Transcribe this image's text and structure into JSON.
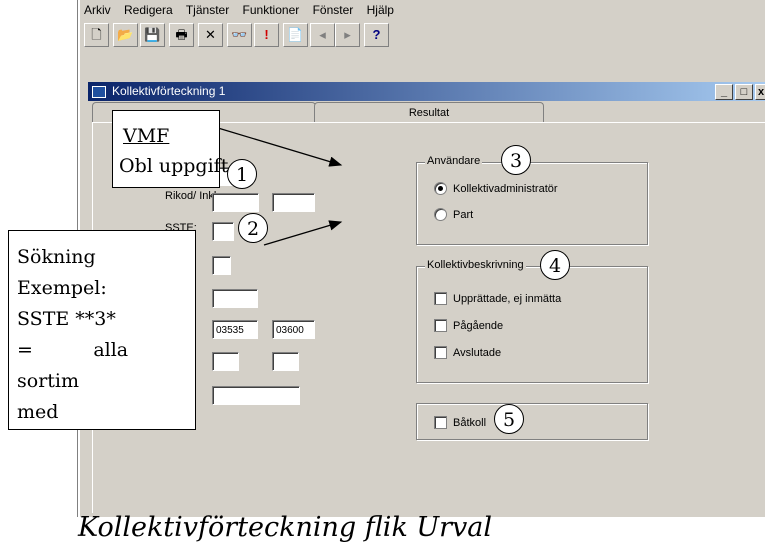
{
  "menu": [
    "Arkiv",
    "Redigera",
    "Tjänster",
    "Funktioner",
    "Fönster",
    "Hjälp"
  ],
  "toolbar": {
    "buttons": [
      {
        "name": "new-icon",
        "glyph": "🗋"
      },
      {
        "name": "open-icon",
        "glyph": "📂"
      },
      {
        "name": "save-icon",
        "glyph": "💾"
      },
      {
        "name": "print-icon",
        "glyph": "🖶"
      },
      {
        "name": "delete-icon",
        "glyph": "✕"
      },
      {
        "name": "binoculars-icon",
        "glyph": "👓"
      },
      {
        "name": "alert-icon",
        "glyph": "!"
      },
      {
        "name": "new-document-icon",
        "glyph": "📄"
      },
      {
        "name": "prev-icon",
        "glyph": "◂"
      },
      {
        "name": "next-icon",
        "glyph": "▸"
      },
      {
        "name": "help-icon",
        "glyph": "?"
      }
    ]
  },
  "window": {
    "title": "Kollektivförteckning 1",
    "minimize": "_",
    "maximize": "□",
    "close": "x"
  },
  "tabs": {
    "active": "",
    "result": "Resultat"
  },
  "fields": {
    "label_rikod": "Rikod/ Inkl:",
    "label_sste": "SSTE:",
    "range_from": "03535",
    "range_to": "03600"
  },
  "groups": {
    "user": {
      "label": "Användare",
      "options": [
        {
          "label": "Kollektivadministratör",
          "checked": true
        },
        {
          "label": "Part",
          "checked": false
        }
      ]
    },
    "description": {
      "label": "Kollektivbeskrivning",
      "options": [
        "Upprättade, ej inmätta",
        "Pågående",
        "Avslutade"
      ]
    },
    "boat": {
      "label": "Båtkoll"
    }
  },
  "callouts": {
    "vmf_title": "VMF",
    "vmf_text": "Obl uppgift",
    "search_lines": [
      "Sökning",
      "Exempel:",
      "SSTE **3*",
      "=          alla",
      "sortim",
      "med"
    ]
  },
  "markers": [
    "1",
    "2",
    "3",
    "4",
    "5"
  ],
  "caption": "Kollektivförteckning flik Urval",
  "colors": {
    "window_bg": "#d4d0c8",
    "titlebar": "#0a246a"
  }
}
